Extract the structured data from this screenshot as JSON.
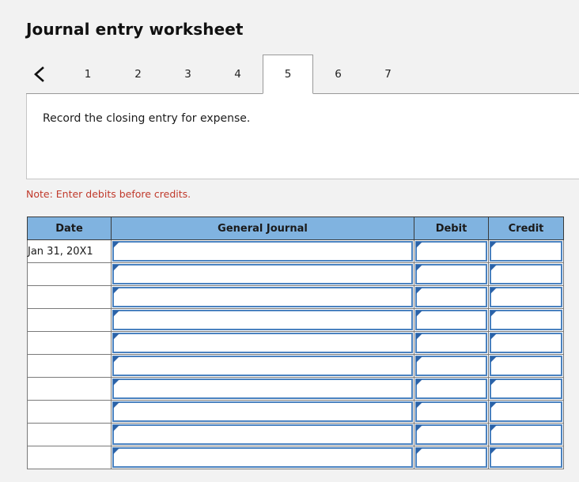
{
  "header": {
    "title": "Journal entry worksheet"
  },
  "tabs": {
    "back_icon": "chevron-left-icon",
    "items": [
      {
        "label": "1",
        "active": false
      },
      {
        "label": "2",
        "active": false
      },
      {
        "label": "3",
        "active": false
      },
      {
        "label": "4",
        "active": false
      },
      {
        "label": "5",
        "active": true
      },
      {
        "label": "6",
        "active": false
      },
      {
        "label": "7",
        "active": false
      }
    ]
  },
  "prompt": {
    "text": "Record the closing entry for expense."
  },
  "note": {
    "text": "Note: Enter debits before credits."
  },
  "table": {
    "columns": [
      "Date",
      "General Journal",
      "Debit",
      "Credit"
    ],
    "rows": [
      {
        "date": "Jan 31, 20X1",
        "general_journal": "",
        "debit": "",
        "credit": ""
      },
      {
        "date": "",
        "general_journal": "",
        "debit": "",
        "credit": ""
      },
      {
        "date": "",
        "general_journal": "",
        "debit": "",
        "credit": ""
      },
      {
        "date": "",
        "general_journal": "",
        "debit": "",
        "credit": ""
      },
      {
        "date": "",
        "general_journal": "",
        "debit": "",
        "credit": ""
      },
      {
        "date": "",
        "general_journal": "",
        "debit": "",
        "credit": ""
      },
      {
        "date": "",
        "general_journal": "",
        "debit": "",
        "credit": ""
      },
      {
        "date": "",
        "general_journal": "",
        "debit": "",
        "credit": ""
      },
      {
        "date": "",
        "general_journal": "",
        "debit": "",
        "credit": ""
      },
      {
        "date": "",
        "general_journal": "",
        "debit": "",
        "credit": ""
      }
    ]
  },
  "colors": {
    "header_blue": "#80b3e0",
    "input_border_blue": "#4a82c0",
    "marker_blue": "#2c63a8",
    "note_red": "#c0392b",
    "page_background": "#f2f2f2"
  }
}
